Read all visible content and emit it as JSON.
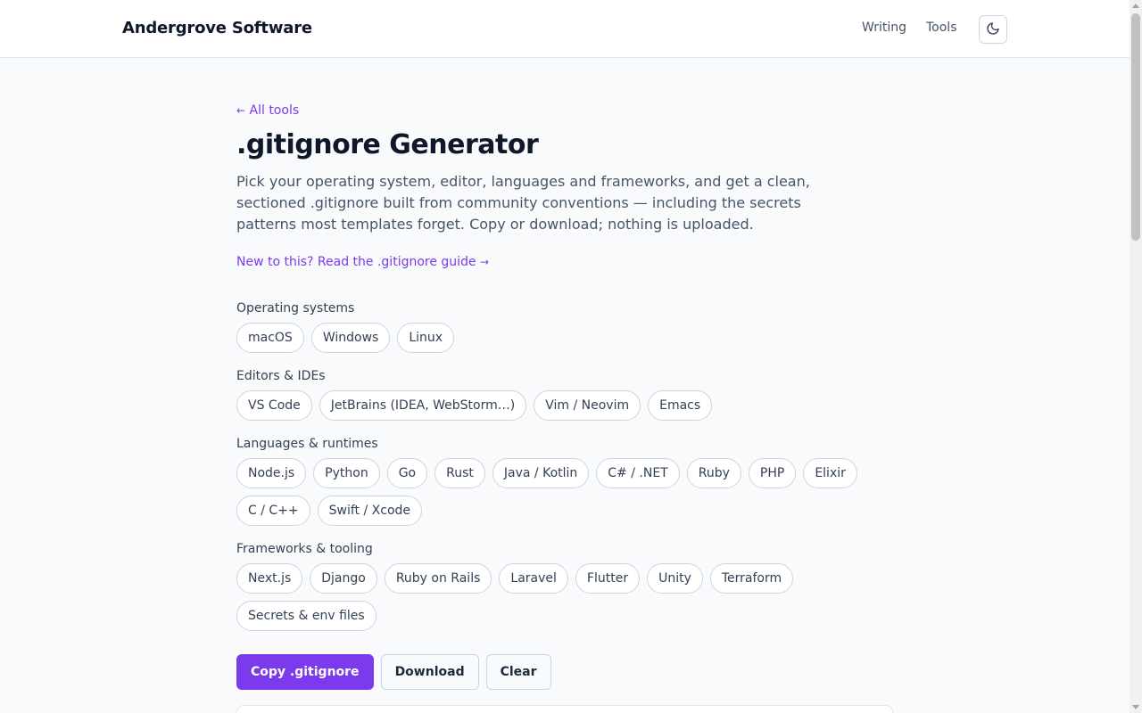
{
  "header": {
    "brand": "Andergrove Software",
    "nav": [
      {
        "label": "Writing"
      },
      {
        "label": "Tools"
      }
    ],
    "theme_toggle_icon": "moon-icon"
  },
  "main": {
    "back_link": "All tools",
    "back_arrow": "←",
    "title": ".gitignore Generator",
    "intro": "Pick your operating system, editor, languages and frameworks, and get a clean, sectioned .gitignore built from community conventions — including the secrets patterns most templates forget. Copy or download; nothing is uploaded.",
    "guide_link": "New to this? Read the .gitignore guide",
    "guide_arrow": "→",
    "groups": [
      {
        "label": "Operating systems",
        "options": [
          "macOS",
          "Windows",
          "Linux"
        ]
      },
      {
        "label": "Editors & IDEs",
        "options": [
          "VS Code",
          "JetBrains (IDEA, WebStorm…)",
          "Vim / Neovim",
          "Emacs"
        ]
      },
      {
        "label": "Languages & runtimes",
        "options": [
          "Node.js",
          "Python",
          "Go",
          "Rust",
          "Java / Kotlin",
          "C# / .NET",
          "Ruby",
          "PHP",
          "Elixir",
          "C / C++",
          "Swift / Xcode"
        ]
      },
      {
        "label": "Frameworks & tooling",
        "options": [
          "Next.js",
          "Django",
          "Ruby on Rails",
          "Laravel",
          "Flutter",
          "Unity",
          "Terraform",
          "Secrets & env files"
        ]
      }
    ],
    "actions": {
      "copy": "Copy .gitignore",
      "download": "Download",
      "clear": "Clear"
    }
  },
  "colors": {
    "accent": "#7c3aed",
    "background": "#f8fafc",
    "text": "#0f172a"
  }
}
